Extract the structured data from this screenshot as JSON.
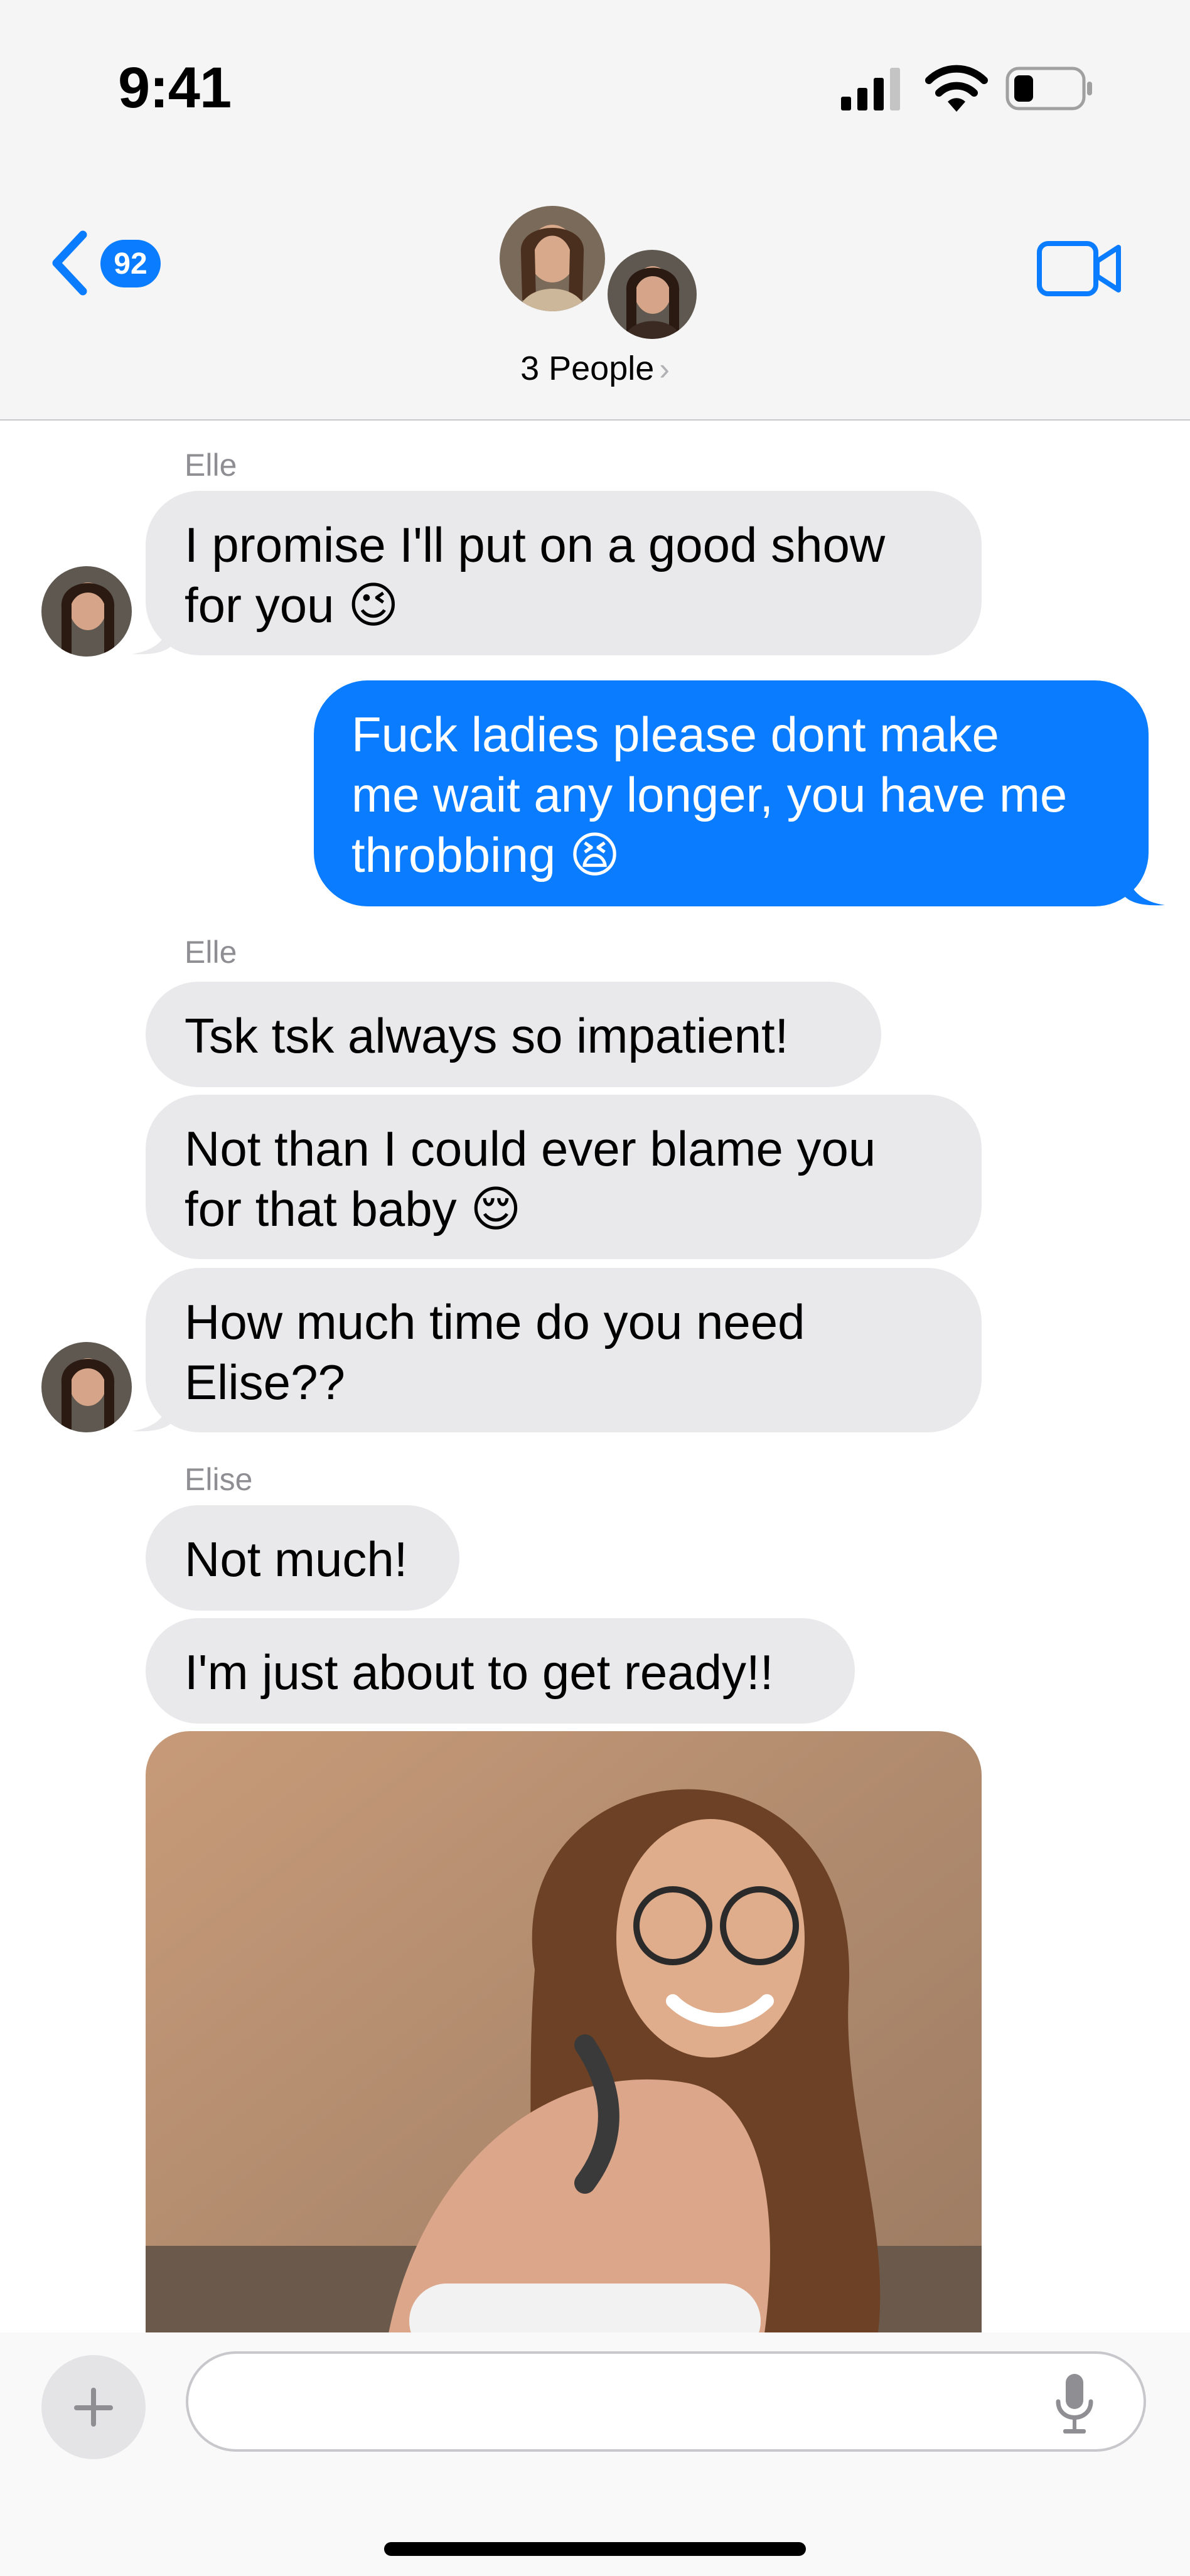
{
  "status_bar": {
    "time": "9:41"
  },
  "nav": {
    "unread_count": "92",
    "group_label": "3 People",
    "group_chevron": "›"
  },
  "messages": [
    {
      "sender": "Elle"
    },
    {
      "text": "I promise I'll put on a good show\nfor you 😉"
    },
    {
      "text": "Fuck ladies please dont make\nme wait any longer, you have me\nthrobbing 😫"
    },
    {
      "sender": "Elle"
    },
    {
      "text": "Tsk tsk always so impatient!"
    },
    {
      "text": "Not than I could ever blame you\nfor that baby 😌"
    },
    {
      "text": "How much time do you need\nElise??"
    },
    {
      "sender": "Elise"
    },
    {
      "text": "Not much!"
    },
    {
      "text": "I'm just about to get ready!!"
    }
  ],
  "icons": {
    "back": "chevron-left-icon",
    "video": "video-camera-icon",
    "add": "plus-icon",
    "mic": "microphone-icon"
  },
  "colors": {
    "accent": "#0a7cff",
    "incoming_bubble": "#e9e9eb",
    "outgoing_bubble": "#0a7cff",
    "bar_background": "#f5f5f5"
  }
}
